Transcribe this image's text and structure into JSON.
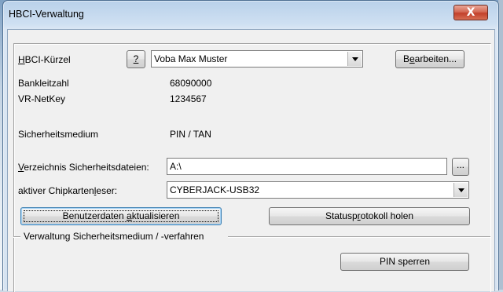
{
  "window": {
    "title": "HBCI-Verwaltung",
    "close_glyph": "X"
  },
  "hbci": {
    "label_prefix": "H",
    "label_rest": "BCI-Kürzel",
    "help_label": "?",
    "selected": "Voba Max Muster",
    "edit_button_pre": "B",
    "edit_button_ul": "e",
    "edit_button_post": "arbeiten..."
  },
  "info": {
    "blz_label": "Bankleitzahl",
    "blz_value": "68090000",
    "vr_label": "VR-NetKey",
    "vr_value": "1234567",
    "medium_label": "Sicherheitsmedium",
    "medium_value": "PIN / TAN"
  },
  "dir": {
    "label_ul": "V",
    "label_rest": "erzeichnis Sicherheitsdateien:",
    "value": "A:\\",
    "browse_label": "..."
  },
  "reader": {
    "label_pre": "aktiver Chipkarten",
    "label_ul": "l",
    "label_post": "eser:",
    "selected": "CYBERJACK-USB32"
  },
  "buttons": {
    "update_pre": "Benutzerdaten ",
    "update_ul": "a",
    "update_post": "ktualisieren",
    "status_pre": "Statusp",
    "status_ul": "r",
    "status_post": "otokoll holen",
    "pin_lock": "PIN sperren"
  },
  "group": {
    "title": "Verwaltung Sicherheitsmedium / -verfahren"
  }
}
